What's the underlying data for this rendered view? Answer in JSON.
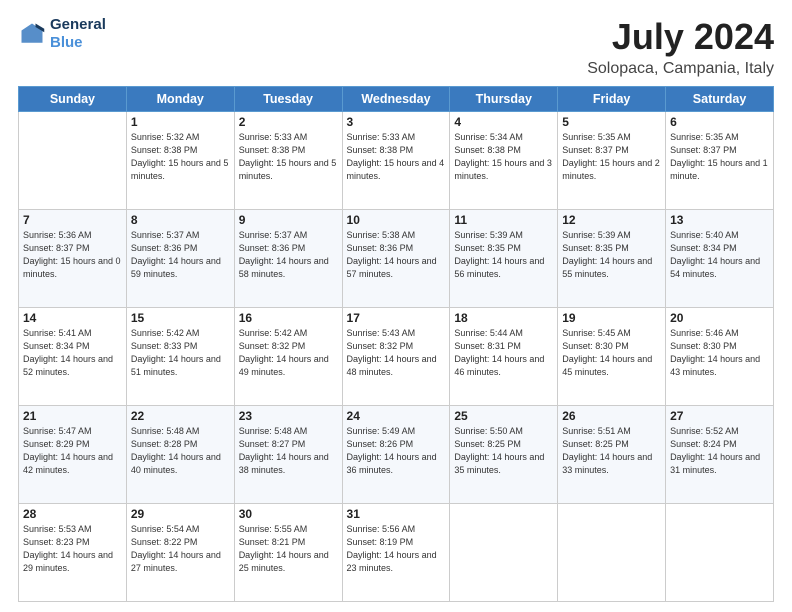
{
  "header": {
    "logo_line1": "General",
    "logo_line2": "Blue",
    "main_title": "July 2024",
    "subtitle": "Solopaca, Campania, Italy"
  },
  "calendar": {
    "headers": [
      "Sunday",
      "Monday",
      "Tuesday",
      "Wednesday",
      "Thursday",
      "Friday",
      "Saturday"
    ],
    "weeks": [
      [
        {
          "day": "",
          "sunrise": "",
          "sunset": "",
          "daylight": ""
        },
        {
          "day": "1",
          "sunrise": "Sunrise: 5:32 AM",
          "sunset": "Sunset: 8:38 PM",
          "daylight": "Daylight: 15 hours and 5 minutes."
        },
        {
          "day": "2",
          "sunrise": "Sunrise: 5:33 AM",
          "sunset": "Sunset: 8:38 PM",
          "daylight": "Daylight: 15 hours and 5 minutes."
        },
        {
          "day": "3",
          "sunrise": "Sunrise: 5:33 AM",
          "sunset": "Sunset: 8:38 PM",
          "daylight": "Daylight: 15 hours and 4 minutes."
        },
        {
          "day": "4",
          "sunrise": "Sunrise: 5:34 AM",
          "sunset": "Sunset: 8:38 PM",
          "daylight": "Daylight: 15 hours and 3 minutes."
        },
        {
          "day": "5",
          "sunrise": "Sunrise: 5:35 AM",
          "sunset": "Sunset: 8:37 PM",
          "daylight": "Daylight: 15 hours and 2 minutes."
        },
        {
          "day": "6",
          "sunrise": "Sunrise: 5:35 AM",
          "sunset": "Sunset: 8:37 PM",
          "daylight": "Daylight: 15 hours and 1 minute."
        }
      ],
      [
        {
          "day": "7",
          "sunrise": "Sunrise: 5:36 AM",
          "sunset": "Sunset: 8:37 PM",
          "daylight": "Daylight: 15 hours and 0 minutes."
        },
        {
          "day": "8",
          "sunrise": "Sunrise: 5:37 AM",
          "sunset": "Sunset: 8:36 PM",
          "daylight": "Daylight: 14 hours and 59 minutes."
        },
        {
          "day": "9",
          "sunrise": "Sunrise: 5:37 AM",
          "sunset": "Sunset: 8:36 PM",
          "daylight": "Daylight: 14 hours and 58 minutes."
        },
        {
          "day": "10",
          "sunrise": "Sunrise: 5:38 AM",
          "sunset": "Sunset: 8:36 PM",
          "daylight": "Daylight: 14 hours and 57 minutes."
        },
        {
          "day": "11",
          "sunrise": "Sunrise: 5:39 AM",
          "sunset": "Sunset: 8:35 PM",
          "daylight": "Daylight: 14 hours and 56 minutes."
        },
        {
          "day": "12",
          "sunrise": "Sunrise: 5:39 AM",
          "sunset": "Sunset: 8:35 PM",
          "daylight": "Daylight: 14 hours and 55 minutes."
        },
        {
          "day": "13",
          "sunrise": "Sunrise: 5:40 AM",
          "sunset": "Sunset: 8:34 PM",
          "daylight": "Daylight: 14 hours and 54 minutes."
        }
      ],
      [
        {
          "day": "14",
          "sunrise": "Sunrise: 5:41 AM",
          "sunset": "Sunset: 8:34 PM",
          "daylight": "Daylight: 14 hours and 52 minutes."
        },
        {
          "day": "15",
          "sunrise": "Sunrise: 5:42 AM",
          "sunset": "Sunset: 8:33 PM",
          "daylight": "Daylight: 14 hours and 51 minutes."
        },
        {
          "day": "16",
          "sunrise": "Sunrise: 5:42 AM",
          "sunset": "Sunset: 8:32 PM",
          "daylight": "Daylight: 14 hours and 49 minutes."
        },
        {
          "day": "17",
          "sunrise": "Sunrise: 5:43 AM",
          "sunset": "Sunset: 8:32 PM",
          "daylight": "Daylight: 14 hours and 48 minutes."
        },
        {
          "day": "18",
          "sunrise": "Sunrise: 5:44 AM",
          "sunset": "Sunset: 8:31 PM",
          "daylight": "Daylight: 14 hours and 46 minutes."
        },
        {
          "day": "19",
          "sunrise": "Sunrise: 5:45 AM",
          "sunset": "Sunset: 8:30 PM",
          "daylight": "Daylight: 14 hours and 45 minutes."
        },
        {
          "day": "20",
          "sunrise": "Sunrise: 5:46 AM",
          "sunset": "Sunset: 8:30 PM",
          "daylight": "Daylight: 14 hours and 43 minutes."
        }
      ],
      [
        {
          "day": "21",
          "sunrise": "Sunrise: 5:47 AM",
          "sunset": "Sunset: 8:29 PM",
          "daylight": "Daylight: 14 hours and 42 minutes."
        },
        {
          "day": "22",
          "sunrise": "Sunrise: 5:48 AM",
          "sunset": "Sunset: 8:28 PM",
          "daylight": "Daylight: 14 hours and 40 minutes."
        },
        {
          "day": "23",
          "sunrise": "Sunrise: 5:48 AM",
          "sunset": "Sunset: 8:27 PM",
          "daylight": "Daylight: 14 hours and 38 minutes."
        },
        {
          "day": "24",
          "sunrise": "Sunrise: 5:49 AM",
          "sunset": "Sunset: 8:26 PM",
          "daylight": "Daylight: 14 hours and 36 minutes."
        },
        {
          "day": "25",
          "sunrise": "Sunrise: 5:50 AM",
          "sunset": "Sunset: 8:25 PM",
          "daylight": "Daylight: 14 hours and 35 minutes."
        },
        {
          "day": "26",
          "sunrise": "Sunrise: 5:51 AM",
          "sunset": "Sunset: 8:25 PM",
          "daylight": "Daylight: 14 hours and 33 minutes."
        },
        {
          "day": "27",
          "sunrise": "Sunrise: 5:52 AM",
          "sunset": "Sunset: 8:24 PM",
          "daylight": "Daylight: 14 hours and 31 minutes."
        }
      ],
      [
        {
          "day": "28",
          "sunrise": "Sunrise: 5:53 AM",
          "sunset": "Sunset: 8:23 PM",
          "daylight": "Daylight: 14 hours and 29 minutes."
        },
        {
          "day": "29",
          "sunrise": "Sunrise: 5:54 AM",
          "sunset": "Sunset: 8:22 PM",
          "daylight": "Daylight: 14 hours and 27 minutes."
        },
        {
          "day": "30",
          "sunrise": "Sunrise: 5:55 AM",
          "sunset": "Sunset: 8:21 PM",
          "daylight": "Daylight: 14 hours and 25 minutes."
        },
        {
          "day": "31",
          "sunrise": "Sunrise: 5:56 AM",
          "sunset": "Sunset: 8:19 PM",
          "daylight": "Daylight: 14 hours and 23 minutes."
        },
        {
          "day": "",
          "sunrise": "",
          "sunset": "",
          "daylight": ""
        },
        {
          "day": "",
          "sunrise": "",
          "sunset": "",
          "daylight": ""
        },
        {
          "day": "",
          "sunrise": "",
          "sunset": "",
          "daylight": ""
        }
      ]
    ]
  }
}
